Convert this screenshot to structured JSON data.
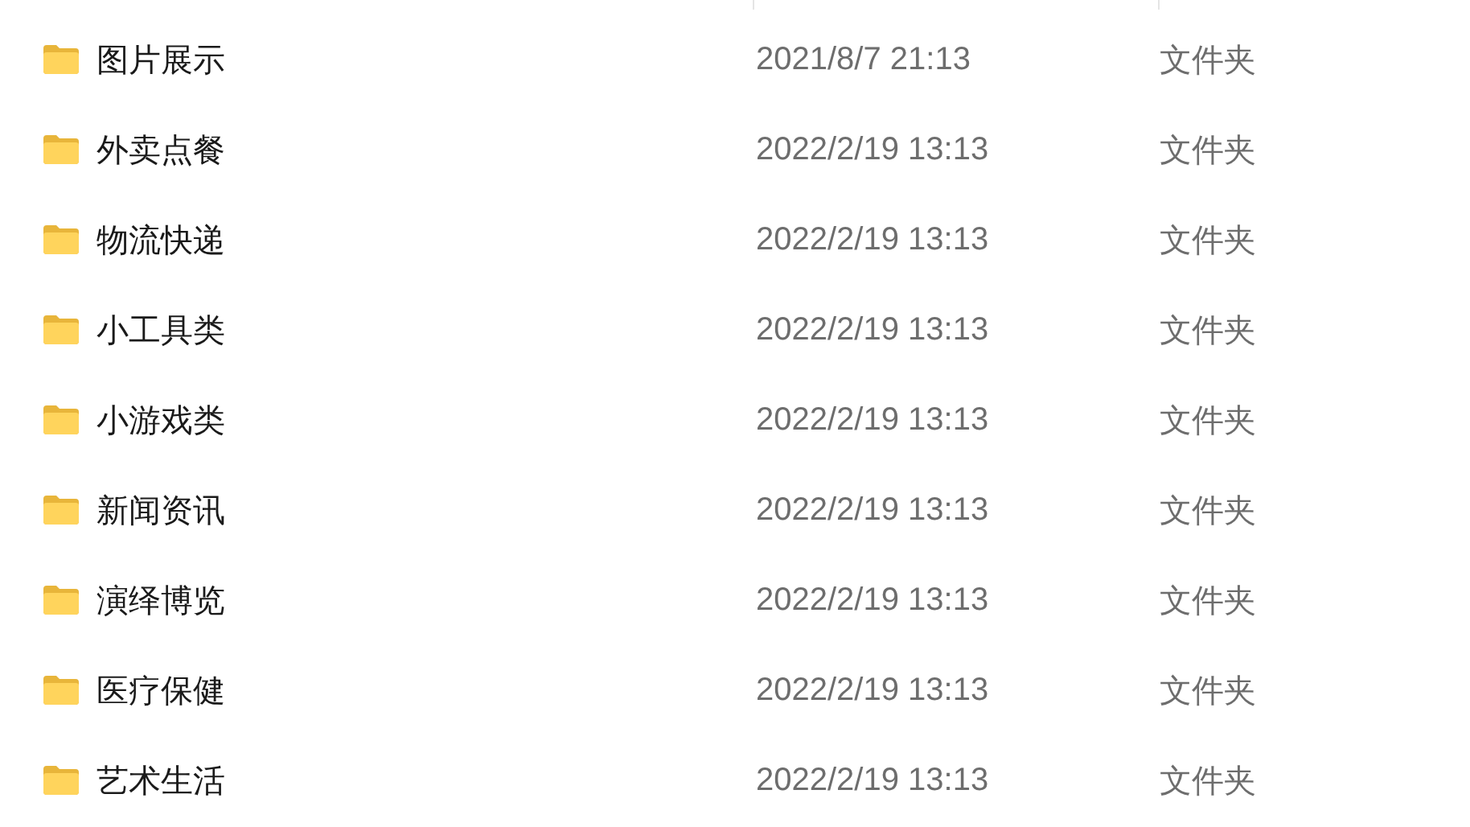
{
  "files": [
    {
      "name": "图片展示",
      "modified": "2021/8/7 21:13",
      "type": "文件夹"
    },
    {
      "name": "外卖点餐",
      "modified": "2022/2/19 13:13",
      "type": "文件夹"
    },
    {
      "name": "物流快递",
      "modified": "2022/2/19 13:13",
      "type": "文件夹"
    },
    {
      "name": "小工具类",
      "modified": "2022/2/19 13:13",
      "type": "文件夹"
    },
    {
      "name": "小游戏类",
      "modified": "2022/2/19 13:13",
      "type": "文件夹"
    },
    {
      "name": "新闻资讯",
      "modified": "2022/2/19 13:13",
      "type": "文件夹"
    },
    {
      "name": "演绎博览",
      "modified": "2022/2/19 13:13",
      "type": "文件夹"
    },
    {
      "name": "医疗保健",
      "modified": "2022/2/19 13:13",
      "type": "文件夹"
    },
    {
      "name": "艺术生活",
      "modified": "2022/2/19 13:13",
      "type": "文件夹"
    }
  ]
}
